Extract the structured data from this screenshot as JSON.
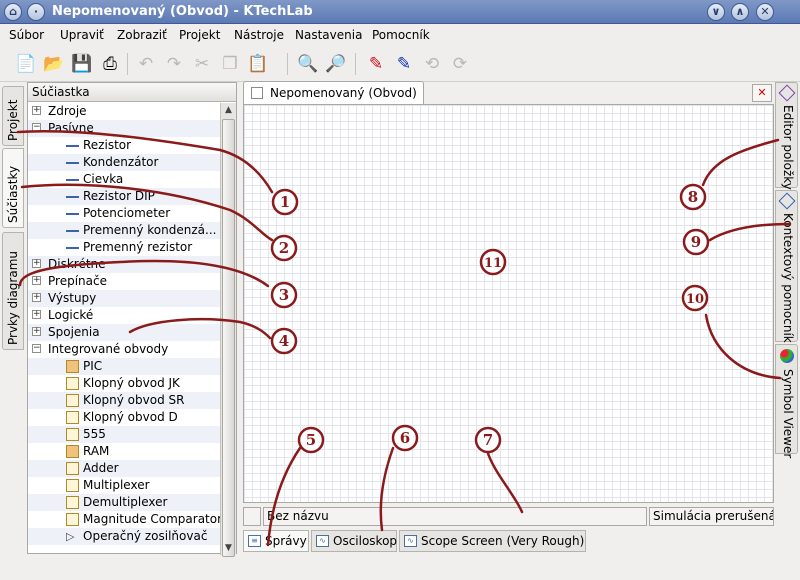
{
  "window": {
    "title": "Nepomenovaný (Obvod) - KTechLab"
  },
  "menu": [
    "Súbor",
    "Upraviť",
    "Zobraziť",
    "Projekt",
    "Nástroje",
    "Nastavenia",
    "Pomocník"
  ],
  "left_tabs": {
    "project": "Projekt",
    "components": "Súčiastky",
    "diagram": "Prvky diagramu"
  },
  "panel": {
    "header": "Súčiastka"
  },
  "tree": [
    {
      "label": "Zdroje",
      "expander": "+",
      "level": 0
    },
    {
      "label": "Pasívne",
      "expander": "−",
      "level": 0
    },
    {
      "label": "Rezistor",
      "level": 1,
      "icon": "resistor-icon"
    },
    {
      "label": "Kondenzátor",
      "level": 1,
      "icon": "capacitor-icon"
    },
    {
      "label": "Cievka",
      "level": 1,
      "icon": "inductor-icon"
    },
    {
      "label": "Rezistor DIP",
      "level": 1,
      "icon": "resistor-dip-icon"
    },
    {
      "label": "Potenciometer",
      "level": 1,
      "icon": "potentiometer-icon"
    },
    {
      "label": "Premenný kondenzá...",
      "level": 1,
      "icon": "variable-capacitor-icon"
    },
    {
      "label": "Premenný rezistor",
      "level": 1,
      "icon": "variable-resistor-icon"
    },
    {
      "label": "Diskrétne",
      "expander": "+",
      "level": 0
    },
    {
      "label": "Prepínače",
      "expander": "+",
      "level": 0
    },
    {
      "label": "Výstupy",
      "expander": "+",
      "level": 0
    },
    {
      "label": "Logické",
      "expander": "+",
      "level": 0
    },
    {
      "label": "Spojenia",
      "expander": "+",
      "level": 0
    },
    {
      "label": "Integrované obvody",
      "expander": "−",
      "level": 0
    },
    {
      "label": "PIC",
      "level": 1,
      "icon": "pic-chip-icon"
    },
    {
      "label": "Klopný obvod JK",
      "level": 1,
      "icon": "chip-icon"
    },
    {
      "label": "Klopný obvod SR",
      "level": 1,
      "icon": "chip-icon"
    },
    {
      "label": "Klopný obvod D",
      "level": 1,
      "icon": "chip-icon"
    },
    {
      "label": "555",
      "level": 1,
      "icon": "chip-icon"
    },
    {
      "label": "RAM",
      "level": 1,
      "icon": "pic-chip-icon"
    },
    {
      "label": "Adder",
      "level": 1,
      "icon": "chip-icon"
    },
    {
      "label": "Multiplexer",
      "level": 1,
      "icon": "chip-icon"
    },
    {
      "label": "Demultiplexer",
      "level": 1,
      "icon": "chip-icon"
    },
    {
      "label": "Magnitude Comparator",
      "level": 1,
      "icon": "chip-icon"
    },
    {
      "label": "Operačný zosilňovač",
      "level": 1,
      "icon": "opamp-icon"
    }
  ],
  "document_tab": {
    "label": "Nepomenovaný (Obvod)"
  },
  "status": {
    "name": "Bez názvu",
    "simulation": "Simulácia prerušená"
  },
  "bottom_tabs": [
    "Správy",
    "Osciloskop",
    "Scope Screen (Very Rough)"
  ],
  "right_tabs": {
    "item_editor": "Editor položky",
    "context_help": "Kontextový pomocník",
    "symbol_viewer": "Symbol Viewer"
  },
  "annotations": [
    "1",
    "2",
    "3",
    "4",
    "5",
    "6",
    "7",
    "8",
    "9",
    "10",
    "11"
  ],
  "colors": {
    "annotation": "#8b1a1a",
    "titlebar": "#6a85bd",
    "grid": "#e4e4ec"
  }
}
